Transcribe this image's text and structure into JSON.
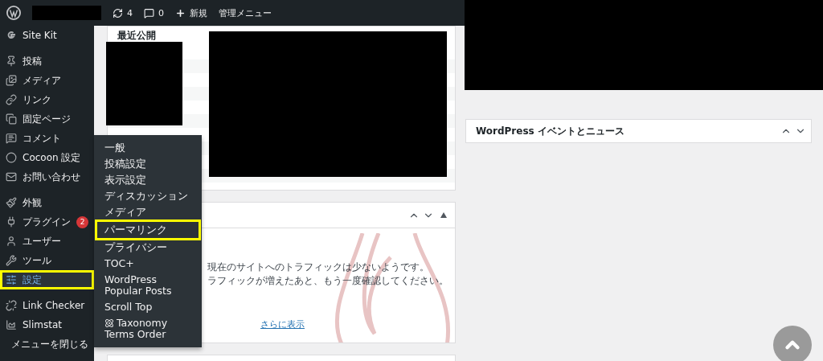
{
  "admin_bar": {
    "items": [
      {
        "kind": "updates",
        "label": "4"
      },
      {
        "kind": "comments",
        "label": "0"
      },
      {
        "kind": "new",
        "label": "新規"
      },
      {
        "kind": "text",
        "label": "管理メニュー"
      }
    ]
  },
  "sidebar": {
    "groups": [
      [
        {
          "label": "Site Kit",
          "selected": false,
          "highlighted": false
        }
      ],
      [
        {
          "label": "投稿",
          "selected": false,
          "highlighted": false
        },
        {
          "label": "メディア",
          "selected": false,
          "highlighted": false
        },
        {
          "label": "リンク",
          "selected": false,
          "highlighted": false
        },
        {
          "label": "固定ページ",
          "selected": false,
          "highlighted": false
        },
        {
          "label": "コメント",
          "selected": false,
          "highlighted": false
        },
        {
          "label": "Cocoon 設定",
          "selected": false,
          "highlighted": false
        },
        {
          "label": "お問い合わせ",
          "selected": false,
          "highlighted": false
        }
      ],
      [
        {
          "label": "外観",
          "selected": false,
          "highlighted": false
        },
        {
          "label": "プラグイン",
          "badge": "2",
          "selected": false,
          "highlighted": false
        },
        {
          "label": "ユーザー",
          "selected": false,
          "highlighted": false
        },
        {
          "label": "ツール",
          "selected": false,
          "highlighted": false
        },
        {
          "label": "設定",
          "selected": true,
          "highlighted": true
        }
      ],
      [
        {
          "label": "Link Checker",
          "selected": false,
          "highlighted": false
        },
        {
          "label": "Slimstat",
          "selected": false,
          "highlighted": false
        },
        {
          "label": "メニューを閉じる",
          "selected": false,
          "highlighted": false
        }
      ]
    ]
  },
  "submenu": {
    "items": [
      {
        "label": "一般",
        "highlighted": false
      },
      {
        "label": "投稿設定",
        "highlighted": false
      },
      {
        "label": "表示設定",
        "highlighted": false
      },
      {
        "label": "ディスカッション",
        "highlighted": false
      },
      {
        "label": "メディア",
        "highlighted": false
      },
      {
        "label": "パーマリンク",
        "highlighted": true
      },
      {
        "label": "プライバシー",
        "highlighted": false
      },
      {
        "label": "TOC+",
        "highlighted": false
      },
      {
        "label": "WordPress Popular Posts",
        "highlighted": false
      },
      {
        "label": "Scroll Top",
        "highlighted": false
      },
      {
        "label": "Taxonomy Terms Order",
        "highlighted": false,
        "icon": true
      }
    ]
  },
  "activity_panel": {
    "title": "最近公開"
  },
  "traffic_panel": {
    "lines": [
      "現在のサイトへのトラフィックは少ないようです。",
      "ラフィックが増えたあと、もう一度確認してください。"
    ],
    "link": "さらに表示"
  },
  "events_panel": {
    "title": "WordPress イベントとニュース"
  }
}
